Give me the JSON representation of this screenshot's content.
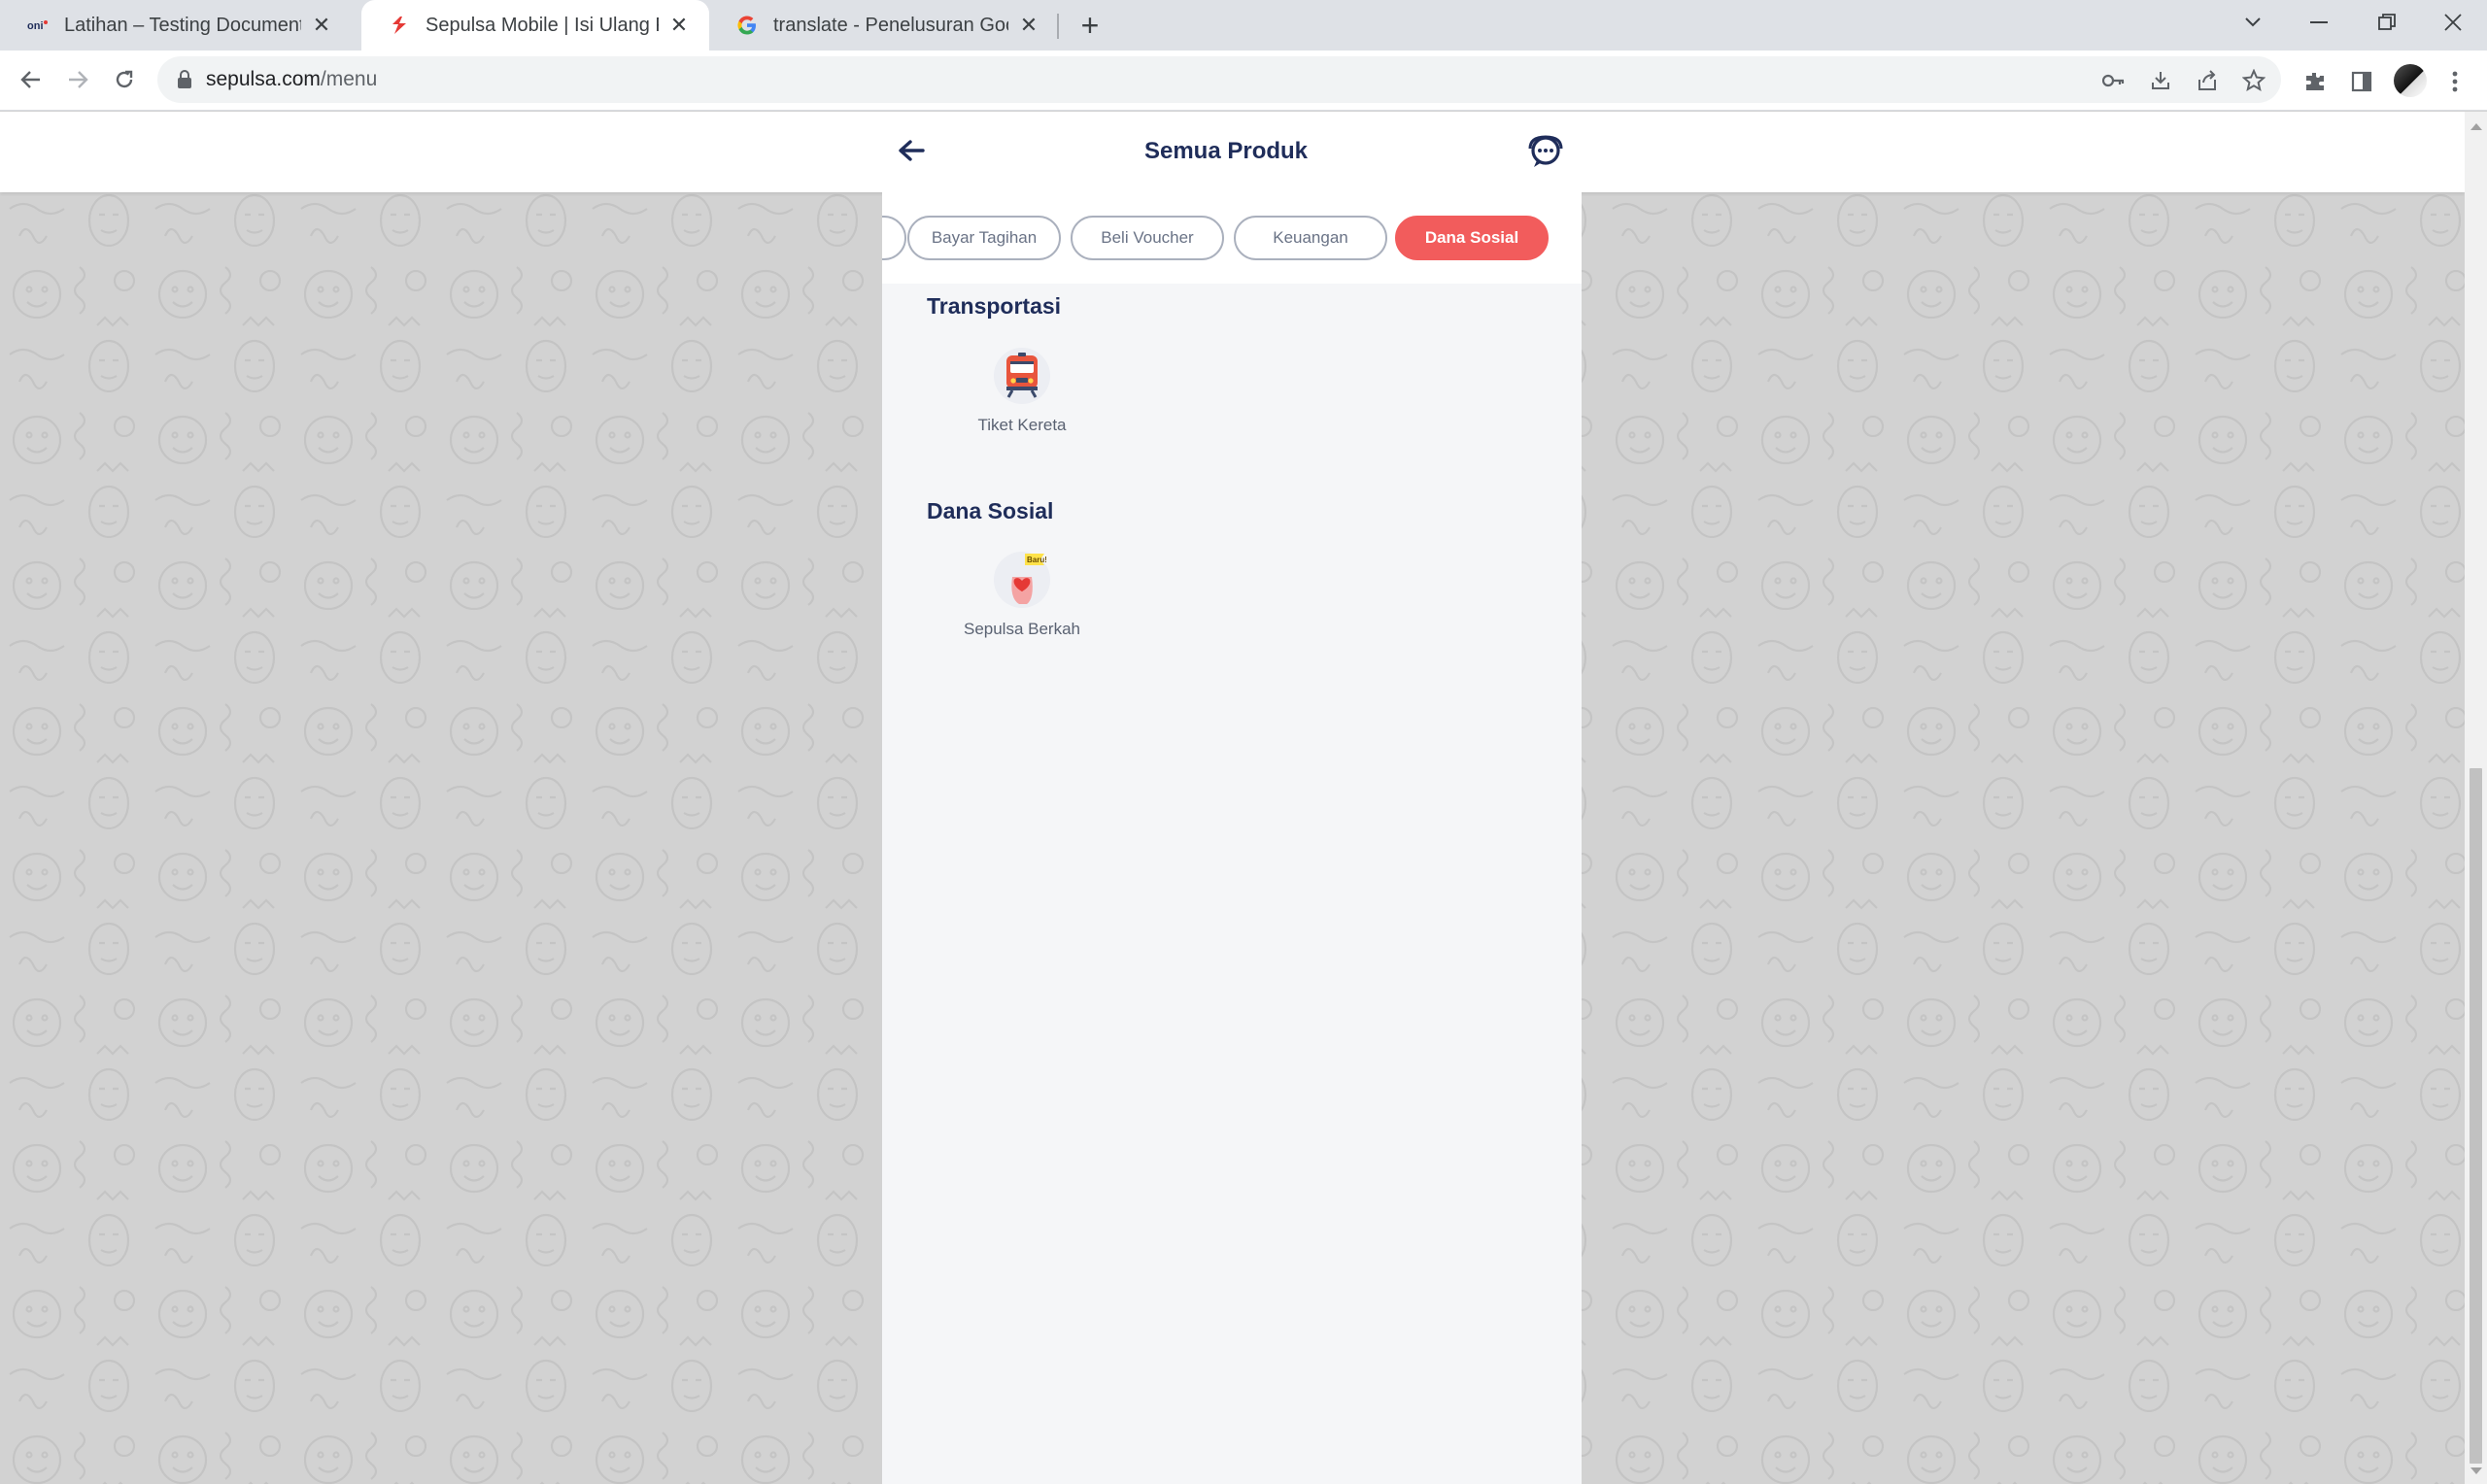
{
  "browser": {
    "tabs": [
      {
        "title": "Latihan – Testing Documentation",
        "favicon": "oni-favicon"
      },
      {
        "title": "Sepulsa Mobile | Isi Ulang Pulsa S",
        "favicon": "sepulsa-favicon"
      },
      {
        "title": "translate - Penelusuran Google",
        "favicon": "google-favicon"
      }
    ],
    "url_domain": "sepulsa.com",
    "url_path": "/menu"
  },
  "header": {
    "title": "Semua Produk"
  },
  "category_tabs": [
    {
      "label": ""
    },
    {
      "label": "Bayar Tagihan"
    },
    {
      "label": "Beli Voucher"
    },
    {
      "label": "Keuangan"
    },
    {
      "label": "Dana Sosial",
      "active": true
    }
  ],
  "sections": [
    {
      "title": "Transportasi",
      "products": [
        {
          "label": "Tiket Kereta",
          "icon": "train-icon"
        }
      ]
    },
    {
      "title": "Dana Sosial",
      "products": [
        {
          "label": "Sepulsa Berkah",
          "icon": "donation-heart-icon",
          "badge": "Baru!"
        }
      ]
    }
  ],
  "colors": {
    "accent": "#f25c5c",
    "title": "#1f2d5a",
    "background": "#d2d2d2"
  }
}
